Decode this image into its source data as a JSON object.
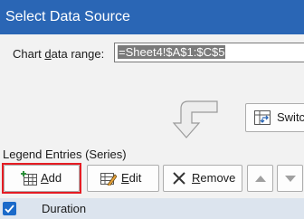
{
  "window": {
    "title": "Select Data Source"
  },
  "data_range": {
    "label_pre": "Chart ",
    "label_accel": "d",
    "label_post": "ata range:",
    "value": "=Sheet4!$A$1:$C$5"
  },
  "switch_button": {
    "label": "Switch",
    "icon": "switch-row-column-icon"
  },
  "legend": {
    "label": "Legend Entries (Series)",
    "buttons": {
      "add": {
        "accel": "A",
        "rest": "dd",
        "icon": "add-table-icon"
      },
      "edit": {
        "accel": "E",
        "rest": "dit",
        "icon": "edit-table-icon"
      },
      "remove": {
        "accel": "R",
        "rest": "emove",
        "icon": "x-icon"
      },
      "up": {
        "icon": "triangle-up-icon"
      },
      "down": {
        "icon": "triangle-down-icon"
      }
    },
    "series": [
      {
        "name": "Duration",
        "checked": true
      }
    ]
  },
  "colors": {
    "title_bar": "#2a66b5",
    "highlight_border": "#e51c23",
    "selected_row": "#dce4ee",
    "checkbox": "#1b6ac9"
  }
}
